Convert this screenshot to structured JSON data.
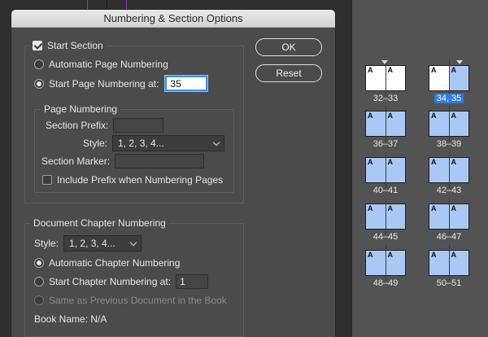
{
  "dialog": {
    "title": "Numbering & Section Options",
    "start_section_label": "Start Section",
    "auto_page_numbering_label": "Automatic Page Numbering",
    "start_page_numbering_label": "Start Page Numbering at:",
    "start_page_value": "35",
    "page_numbering": {
      "legend": "Page Numbering",
      "section_prefix_label": "Section Prefix:",
      "section_prefix_value": "",
      "style_label": "Style:",
      "style_value": "1, 2, 3, 4...",
      "section_marker_label": "Section Marker:",
      "section_marker_value": "",
      "include_prefix_label": "Include Prefix when Numbering Pages"
    },
    "chapter_numbering": {
      "legend": "Document Chapter Numbering",
      "style_label": "Style:",
      "style_value": "1, 2, 3, 4...",
      "auto_chapter_label": "Automatic Chapter Numbering",
      "start_chapter_label": "Start Chapter Numbering at:",
      "start_chapter_value": "1",
      "same_as_previous_label": "Same as Previous Document in the Book",
      "book_name_label": "Book Name: N/A"
    },
    "buttons": {
      "ok": "OK",
      "reset": "Reset"
    }
  },
  "pages_panel": {
    "master_prefix": "A",
    "spreads": [
      {
        "label": "32–33",
        "selected": false
      },
      {
        "label": "34, 35",
        "selected": true
      },
      {
        "label": "36–37",
        "selected": false
      },
      {
        "label": "38–39",
        "selected": false
      },
      {
        "label": "40–41",
        "selected": false
      },
      {
        "label": "42–43",
        "selected": false
      },
      {
        "label": "44–45",
        "selected": false
      },
      {
        "label": "46–47",
        "selected": false
      },
      {
        "label": "48–49",
        "selected": false
      },
      {
        "label": "50–51",
        "selected": false
      }
    ]
  },
  "colors": {
    "page_fill": "#a9c9f4",
    "selection": "#2f7de0",
    "focus_ring": "#3b8ff0",
    "dialog_bg": "#4b4b4b"
  }
}
